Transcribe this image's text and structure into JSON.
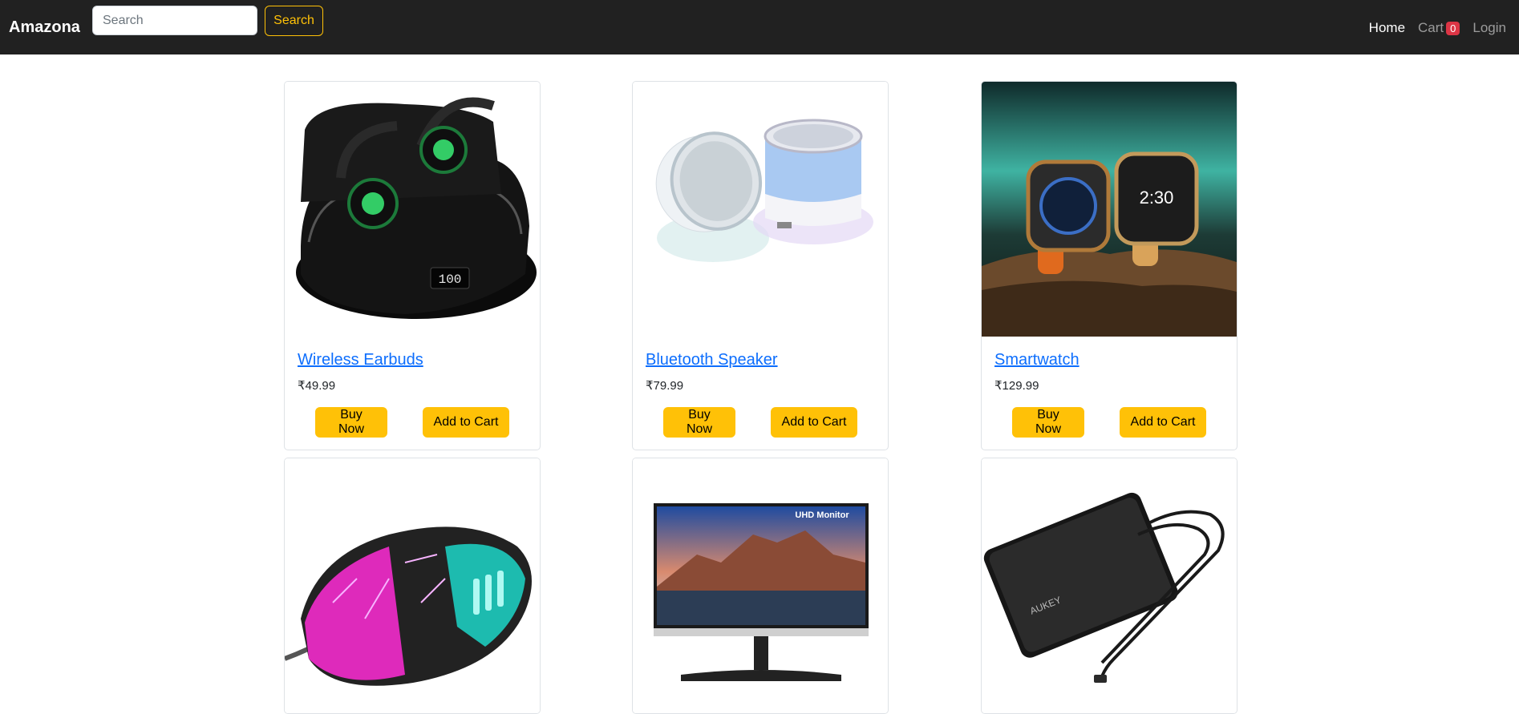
{
  "navbar": {
    "brand": "Amazona",
    "search_placeholder": "Search",
    "search_button": "Search",
    "links": {
      "home": "Home",
      "cart": "Cart",
      "cart_count": "0",
      "login": "Login"
    }
  },
  "products": [
    {
      "name": "Wireless Earbuds",
      "price": "₹49.99",
      "buy": "Buy Now",
      "add": "Add to Cart",
      "image": "wireless-earbuds"
    },
    {
      "name": "Bluetooth Speaker",
      "price": "₹79.99",
      "buy": "Buy Now",
      "add": "Add to Cart",
      "image": "bluetooth-speaker"
    },
    {
      "name": "Smartwatch",
      "price": "₹129.99",
      "buy": "Buy Now",
      "add": "Add to Cart",
      "image": "smartwatch"
    },
    {
      "image": "gaming-mouse"
    },
    {
      "image": "uhd-monitor",
      "image_text": "UHD Monitor"
    },
    {
      "image": "external-hard-drive",
      "image_text": "AUKEY"
    }
  ],
  "colors": {
    "navbar": "#212121",
    "accent": "#ffc107",
    "link": "#0d6efd",
    "badge": "#dc3545"
  }
}
